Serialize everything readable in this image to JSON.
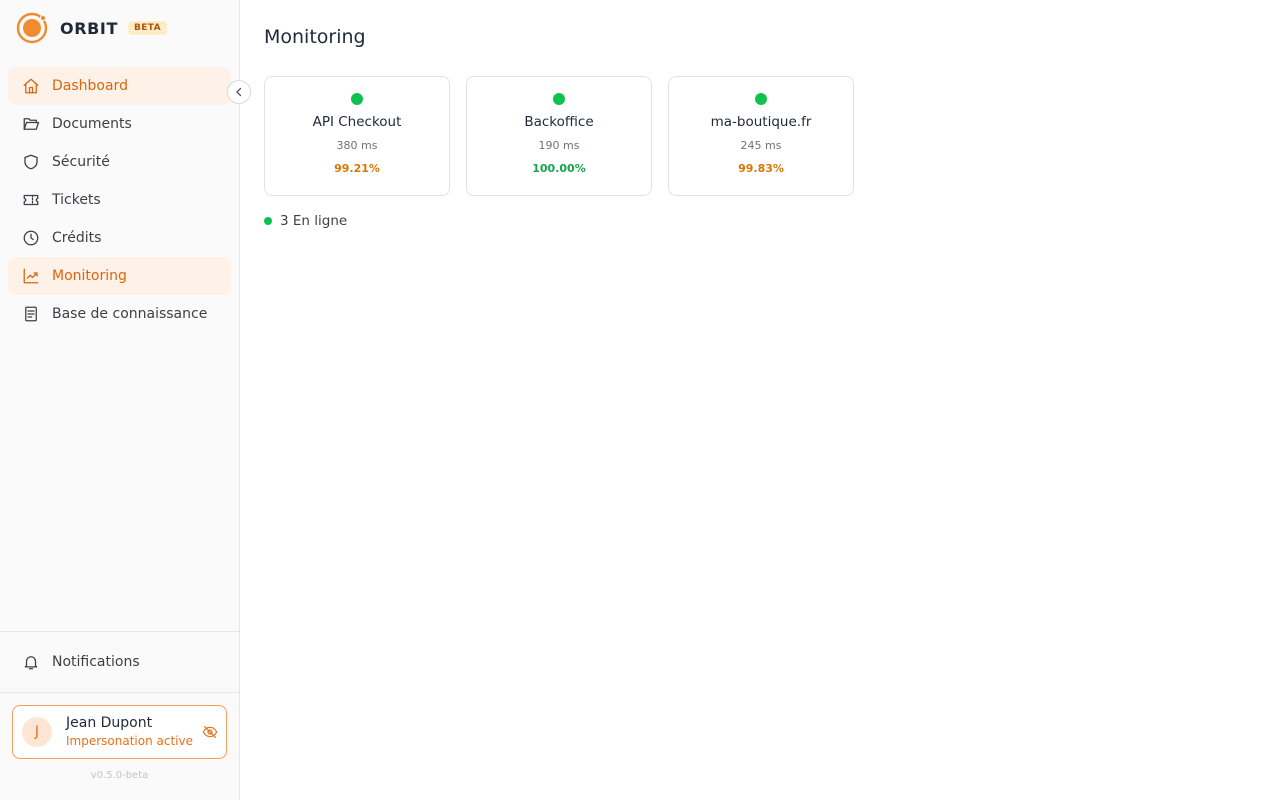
{
  "brand": {
    "name": "ORBIT",
    "badge": "BETA",
    "accent": "#e8711a"
  },
  "sidebar": {
    "items": [
      {
        "label": "Dashboard",
        "icon": "home-icon",
        "active": true
      },
      {
        "label": "Documents",
        "icon": "folder-open-icon",
        "active": false
      },
      {
        "label": "Sécurité",
        "icon": "shield-icon",
        "active": false
      },
      {
        "label": "Tickets",
        "icon": "ticket-icon",
        "active": false
      },
      {
        "label": "Crédits",
        "icon": "clock-icon",
        "active": false
      },
      {
        "label": "Monitoring",
        "icon": "trending-up-icon",
        "active": true
      },
      {
        "label": "Base de connaissance",
        "icon": "document-list-icon",
        "active": false
      }
    ],
    "notifications_label": "Notifications"
  },
  "user": {
    "initial": "J",
    "name": "Jean Dupont",
    "status": "Impersonation active"
  },
  "version": "v0.5.0-beta",
  "main": {
    "title": "Monitoring",
    "monitors": [
      {
        "name": "API Checkout",
        "latency": "380 ms",
        "uptime": "99.21%",
        "uptime_color": "#d97706",
        "status_color": "#0fc24f"
      },
      {
        "name": "Backoffice",
        "latency": "190 ms",
        "uptime": "100.00%",
        "uptime_color": "#16a34a",
        "status_color": "#0fc24f"
      },
      {
        "name": "ma-boutique.fr",
        "latency": "245 ms",
        "uptime": "99.83%",
        "uptime_color": "#d97706",
        "status_color": "#0fc24f"
      }
    ],
    "summary": "3 En ligne"
  }
}
